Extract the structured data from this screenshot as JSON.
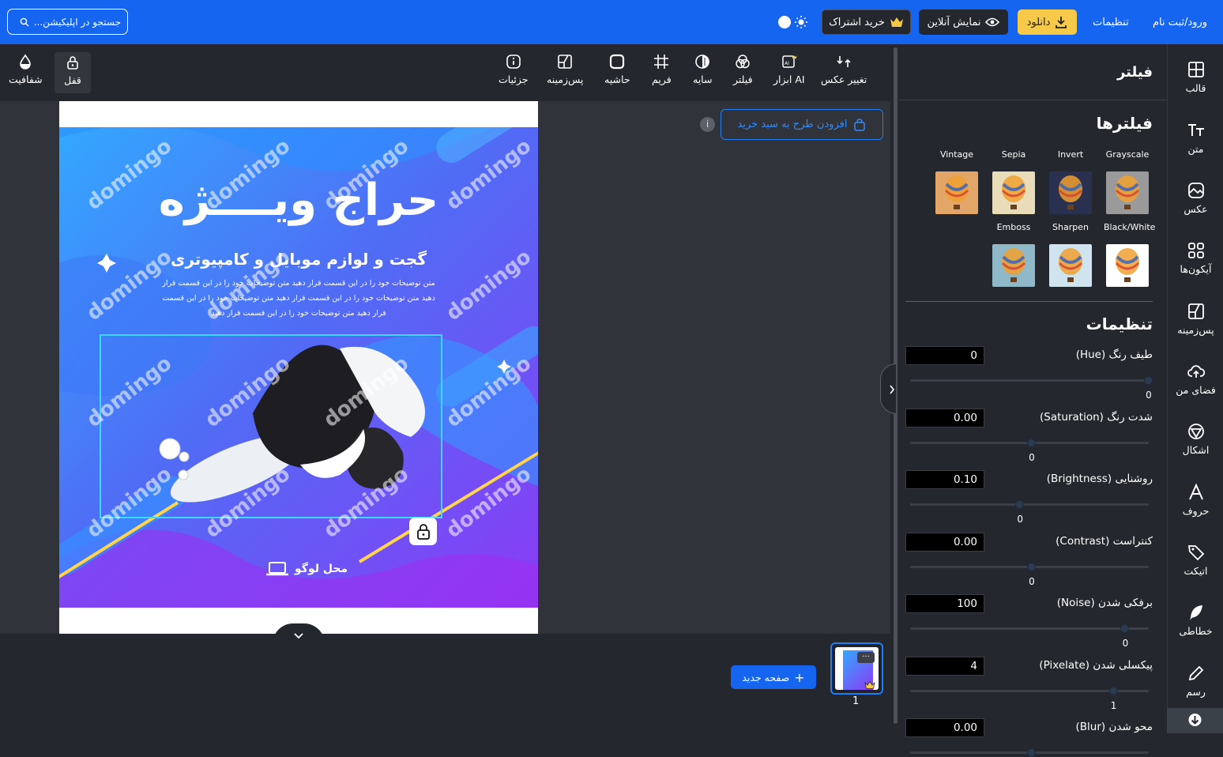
{
  "topbar": {
    "search_placeholder": "جستجو در اپلیکیشن...",
    "login": "ورود/ثبت نام",
    "settings": "تنظیمات",
    "download": "دانلود",
    "live_preview": "نمایش آنلاین",
    "subscribe": "خرید اشتراک"
  },
  "toolbar": {
    "change_photo": "تغییر عکس",
    "ai_tools": "ابزار AI",
    "filter": "فیلتر",
    "shadow": "سایه",
    "frame": "فریم",
    "border": "حاشیه",
    "background": "پس‌زمینه",
    "details": "جزئیات",
    "lock": "قفل",
    "opacity": "شفافیت"
  },
  "workspace": {
    "add_to_cart": "افزودن طرح به سبد خرید",
    "new_page": "صفحه جدید",
    "page_number": "1"
  },
  "design": {
    "title": "حراج ویــــژه",
    "subtitle": "گجت و لوازم موبایل و کامپیوتری",
    "body_line1": "متن توضیحات خود را در این قسمت قرار دهید متن توضیحات خود را در این قسمت قرار",
    "body_line2": "دهید متن توضیحات خود را در این قسمت قرار دهید متن توضیحات خود را در این قسمت",
    "body_line3": "قرار دهید متن توضیحات خود را در این قسمت قرار دهید",
    "logo_text": "محل لوگو",
    "watermark": "domingo"
  },
  "panel": {
    "header": "فیلتر",
    "filters_title": "فیلترها",
    "filters": [
      {
        "name": "Grayscale",
        "tone": "#9a9a9a"
      },
      {
        "name": "Invert",
        "tone": "#2a3150"
      },
      {
        "name": "Sepia",
        "tone": "#e8ddb8"
      },
      {
        "name": "Vintage",
        "tone": "#e2a768"
      },
      {
        "name": "Black/White",
        "tone": "#ffffff"
      },
      {
        "name": "Sharpen",
        "tone": "#cfe4ef"
      },
      {
        "name": "Emboss",
        "tone": "#8fb8c9"
      }
    ],
    "settings_title": "تنظیمات",
    "settings": [
      {
        "label": "طیف رنگ (Hue)",
        "value": "0",
        "min_label": "0",
        "pos": 1.0
      },
      {
        "label": "شدت رنگ (Saturation)",
        "value": "0.00",
        "min_label": "0",
        "pos": 0.5
      },
      {
        "label": "روشنایی (Brightness)",
        "value": "0.10",
        "min_label": "0",
        "pos": 0.45
      },
      {
        "label": "کنتراست (Contrast)",
        "value": "0.00",
        "min_label": "0",
        "pos": 0.5
      },
      {
        "label": "برفکی شدن (Noise)",
        "value": "100",
        "min_label": "0",
        "pos": 0.9
      },
      {
        "label": "پیکسلی شدن (Pixelate)",
        "value": "4",
        "min_label": "1",
        "pos": 0.85
      },
      {
        "label": "محو شدن (Blur)",
        "value": "0.00",
        "min_label": "",
        "pos": 0.5
      }
    ]
  },
  "sidebar": {
    "template": "قالب",
    "text": "متن",
    "photo": "عکس",
    "icons": "آیکون‌ها",
    "background": "پس‌زمینه",
    "my_space": "فضای من",
    "shapes": "اشکال",
    "letters": "حروف",
    "tag": "اتیکت",
    "calligraphy": "خطاطی",
    "draw": "رسم"
  }
}
